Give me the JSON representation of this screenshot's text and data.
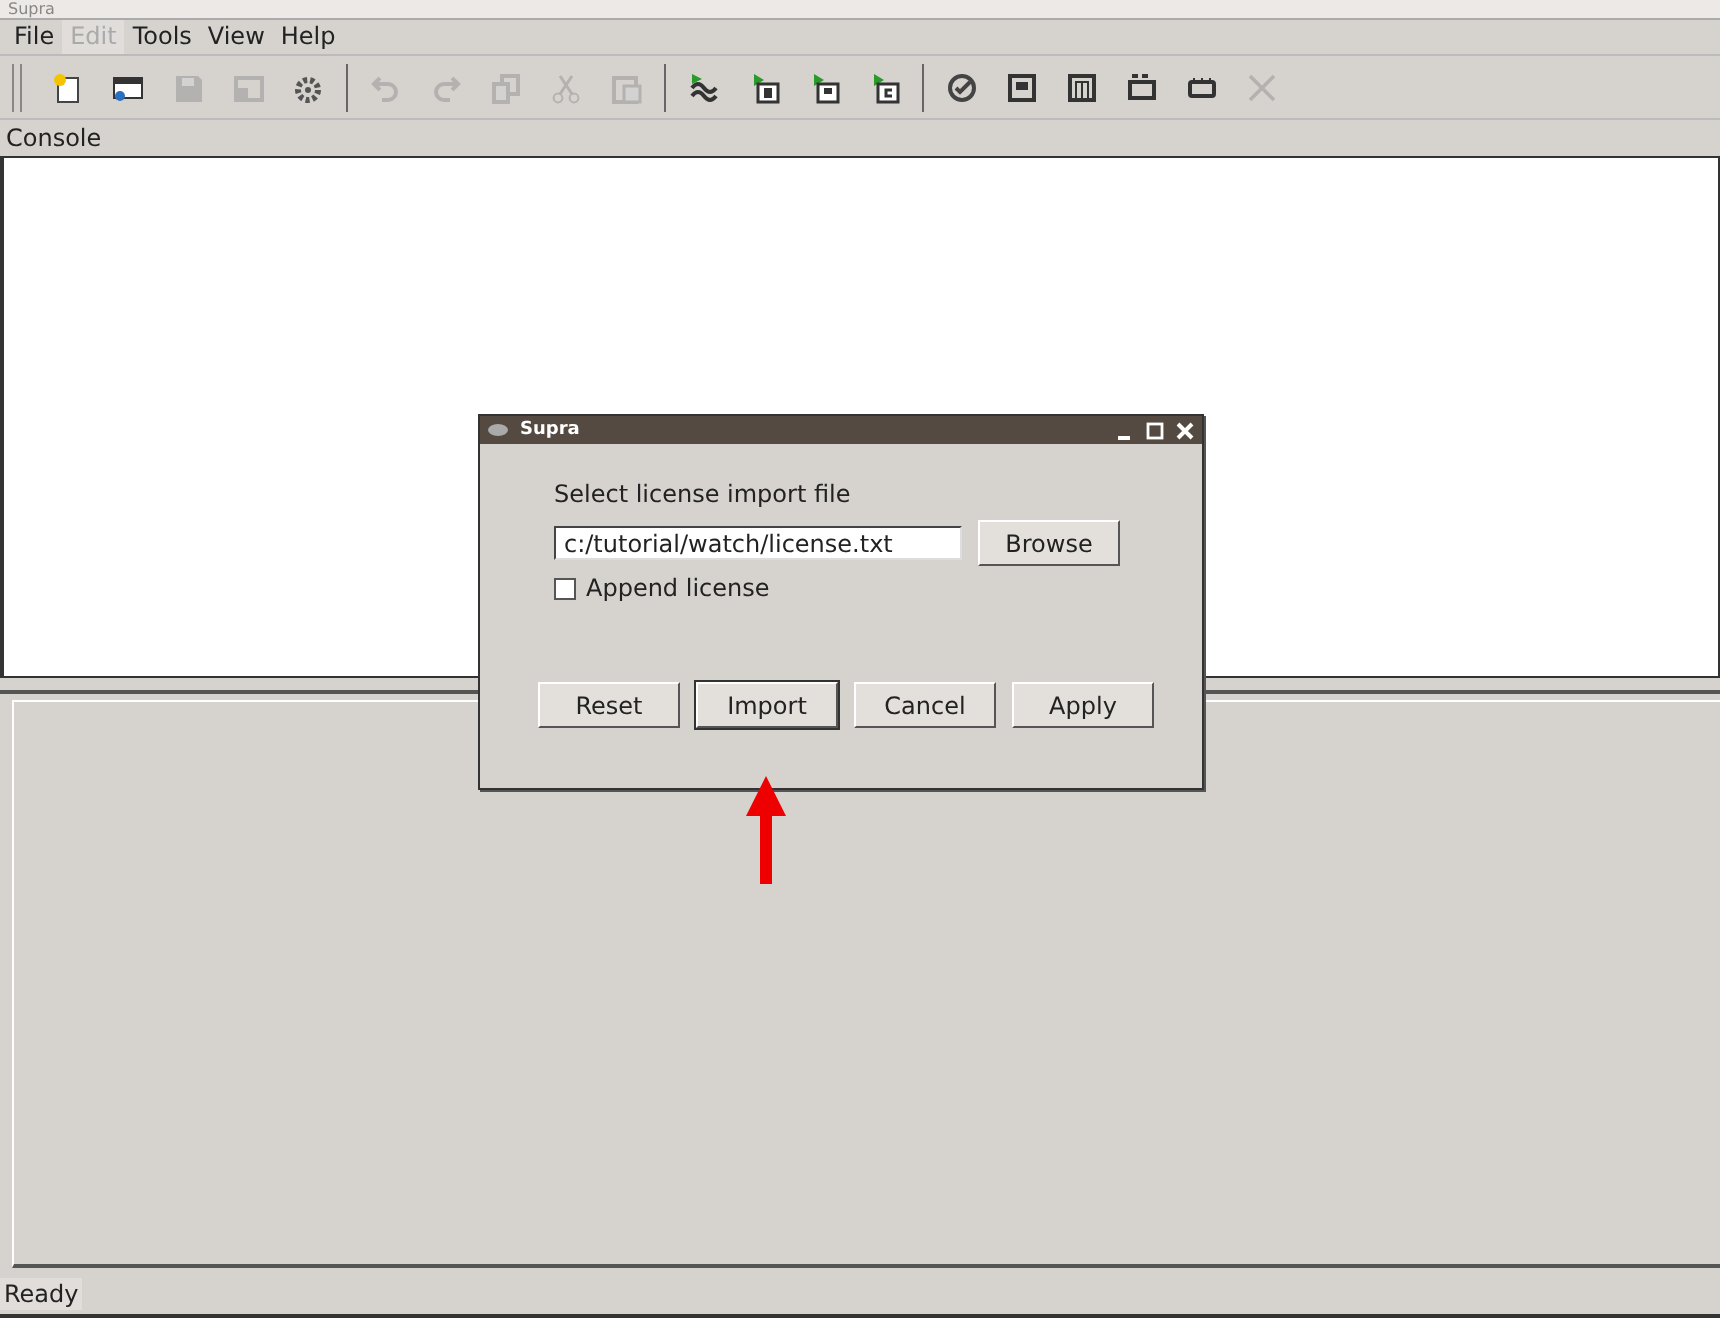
{
  "window": {
    "title": "Supra"
  },
  "menu": [
    {
      "label": "File",
      "disabled": false
    },
    {
      "label": "Edit",
      "disabled": true
    },
    {
      "label": "Tools",
      "disabled": false
    },
    {
      "label": "View",
      "disabled": false
    },
    {
      "label": "Help",
      "disabled": false
    }
  ],
  "toolbar": [
    {
      "kind": "new",
      "disabled": false
    },
    {
      "kind": "open",
      "disabled": false
    },
    {
      "kind": "save",
      "disabled": true
    },
    {
      "kind": "saveas",
      "disabled": true
    },
    {
      "kind": "gear",
      "disabled": false
    },
    {
      "kind": "sep"
    },
    {
      "kind": "undo",
      "disabled": true
    },
    {
      "kind": "redo",
      "disabled": true
    },
    {
      "kind": "copy",
      "disabled": true
    },
    {
      "kind": "cut",
      "disabled": true
    },
    {
      "kind": "paste",
      "disabled": true
    },
    {
      "kind": "sep"
    },
    {
      "kind": "link",
      "disabled": false
    },
    {
      "kind": "flagR",
      "disabled": false
    },
    {
      "kind": "flagP",
      "disabled": false
    },
    {
      "kind": "flagC",
      "disabled": false
    },
    {
      "kind": "sep"
    },
    {
      "kind": "check",
      "disabled": false
    },
    {
      "kind": "boxP",
      "disabled": false
    },
    {
      "kind": "boxM",
      "disabled": false
    },
    {
      "kind": "chip2",
      "disabled": false
    },
    {
      "kind": "chip",
      "disabled": false
    },
    {
      "kind": "close",
      "disabled": true
    }
  ],
  "console": {
    "label": "Console"
  },
  "dialog": {
    "title": "Supra",
    "prompt": "Select license import file",
    "file_value": "c:/tutorial/watch/license.txt",
    "browse": "Browse",
    "append": {
      "label": "Append license",
      "checked": false
    },
    "buttons": [
      {
        "label": "Reset",
        "default": false
      },
      {
        "label": "Import",
        "default": true
      },
      {
        "label": "Cancel",
        "default": false
      },
      {
        "label": "Apply",
        "default": false
      }
    ]
  },
  "status_bar": {
    "text": "Ready"
  }
}
